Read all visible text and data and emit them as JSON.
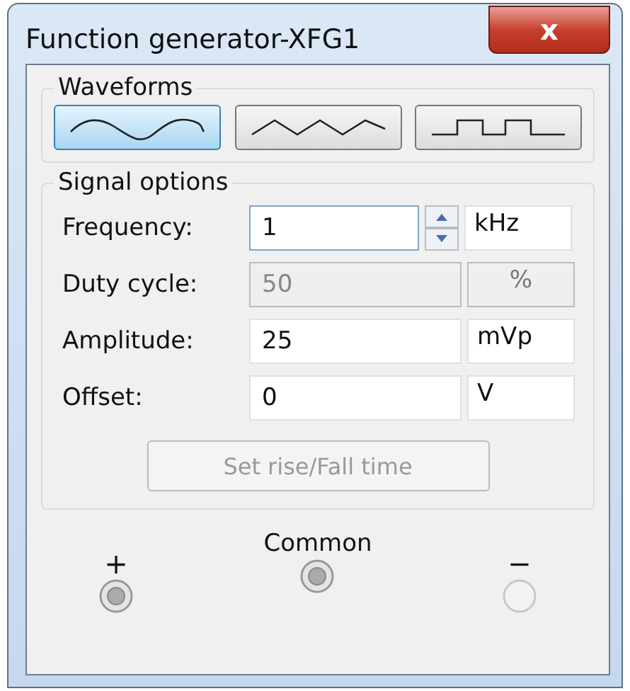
{
  "window": {
    "title": "Function generator-XFG1",
    "close": "x"
  },
  "waveforms": {
    "title": "Waveforms",
    "buttons": [
      {
        "kind": "sine",
        "selected": true
      },
      {
        "kind": "triangle",
        "selected": false
      },
      {
        "kind": "square",
        "selected": false
      }
    ]
  },
  "signal_options": {
    "title": "Signal options",
    "rows": [
      {
        "label": "Frequency:",
        "value": "1",
        "unit": "kHz",
        "disabled": false,
        "spinner": true
      },
      {
        "label": "Duty cycle:",
        "value": "50",
        "unit": "%",
        "disabled": true,
        "spinner": false
      },
      {
        "label": "Amplitude:",
        "value": "25",
        "unit": "mVp",
        "disabled": false,
        "spinner": false
      },
      {
        "label": "Offset:",
        "value": "0",
        "unit": "V",
        "disabled": false,
        "spinner": false
      }
    ],
    "rise_button": {
      "label": "Set rise/Fall time",
      "disabled": true
    }
  },
  "terminals": [
    {
      "symbol": "+",
      "connected": true
    },
    {
      "symbol": "Common",
      "connected": true
    },
    {
      "symbol": "−",
      "connected": false
    }
  ]
}
